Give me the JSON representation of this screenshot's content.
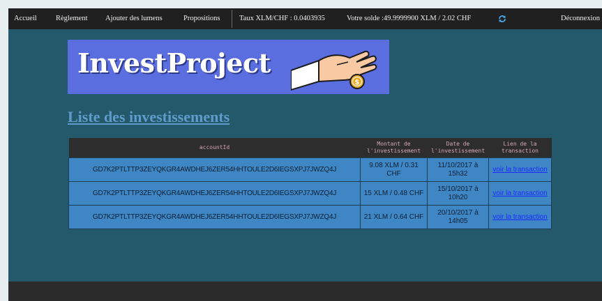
{
  "nav": {
    "items": [
      "Accueil",
      "Règlement",
      "Ajouter des lumens",
      "Propositions"
    ],
    "rate": "Taux XLM/CHF : 0.0403935",
    "balance": "Votre solde :49.9999900 XLM / 2.02 CHF",
    "refresh_icon": "refresh-icon",
    "logout": "Déconnexion"
  },
  "logo": {
    "text": "InvestProject",
    "image": "hand-dropping-coin"
  },
  "heading": "Liste des investissements",
  "table": {
    "headers": [
      "accountId",
      "Montant de l'investissement",
      "Date de l'investissement",
      "Lien de la transaction"
    ],
    "rows": [
      [
        "GD7K2PTLTTP3ZEYQKGR4AWDHEJ6ZER54HHTOULE2D6IEGSXPJ7JWZQ4J",
        "9.08 XLM / 0.31 CHF",
        "11/10/2017 à 15h32",
        "voir la transaction"
      ],
      [
        "GD7K2PTLTTP3ZEYQKGR4AWDHEJ6ZER54HHTOULE2D6IEGSXPJ7JWZQ4J",
        "15 XLM / 0.48 CHF",
        "15/10/2017 à 10h20",
        "voir la transaction"
      ],
      [
        "GD7K2PTLTTP3ZEYQKGR4AWDHEJ6ZER54HHTOULE2D6IEGSXPJ7JWZQ4J",
        "21 XLM / 0.64 CHF",
        "20/10/2017 à 14h05",
        "voir la transaction"
      ]
    ]
  },
  "colors": {
    "navbar": "#202020",
    "page_bg": "#23596a",
    "logo_bg": "#5b6ee0",
    "heading": "#5f9bcc",
    "table_header": "#2d2d2d",
    "table_cell": "#3f86c4",
    "link": "#1b2bff",
    "footer": "#2b2b2b"
  }
}
